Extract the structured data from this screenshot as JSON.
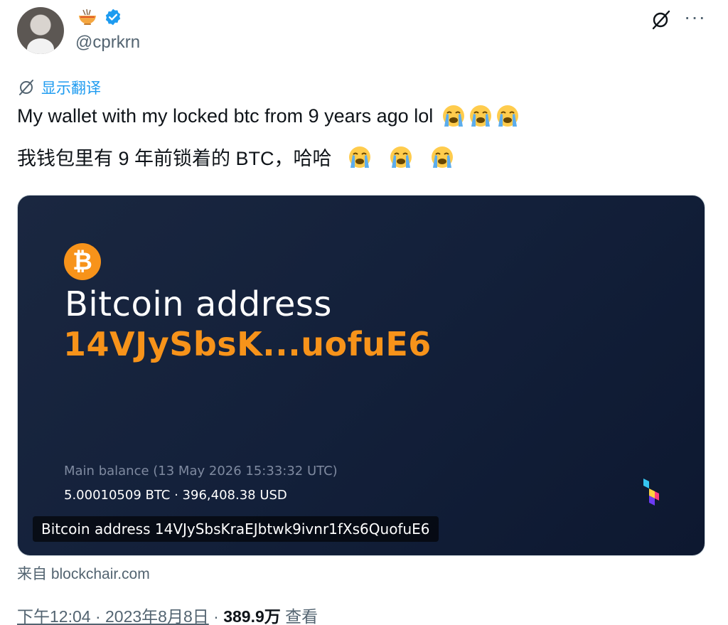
{
  "author": {
    "handle": "@cprkrn",
    "name_icon": "ramen-bowl-emoji",
    "verified_icon": "verified-badge-icon"
  },
  "translate": {
    "label": "显示翻译"
  },
  "tweet": {
    "text_en": "My wallet with my locked btc from 9 years ago lol",
    "text_zh": "我钱包里有 9 年前锁着的 BTC，哈哈",
    "emoji": "loudly-crying-face"
  },
  "card": {
    "title": "Bitcoin address",
    "address_short": "14VJySbsK...uofuE6",
    "balance_label": "Main balance (13 May 2026 15:33:32 UTC)",
    "balance_value": "5.00010509 BTC · 396,408.38 USD",
    "caption": "Bitcoin address 14VJySbsKraEJbtwk9ivnr1fXs6QuofuE6",
    "coin_symbol": "₿",
    "colors": {
      "background": "#13203a",
      "accent": "#f7931a"
    }
  },
  "source": "来自 blockchair.com",
  "meta": {
    "time": "下午12:04 · 2023年8月8日",
    "separator": " · ",
    "views_count": "389.9万",
    "views_label": " 查看"
  }
}
